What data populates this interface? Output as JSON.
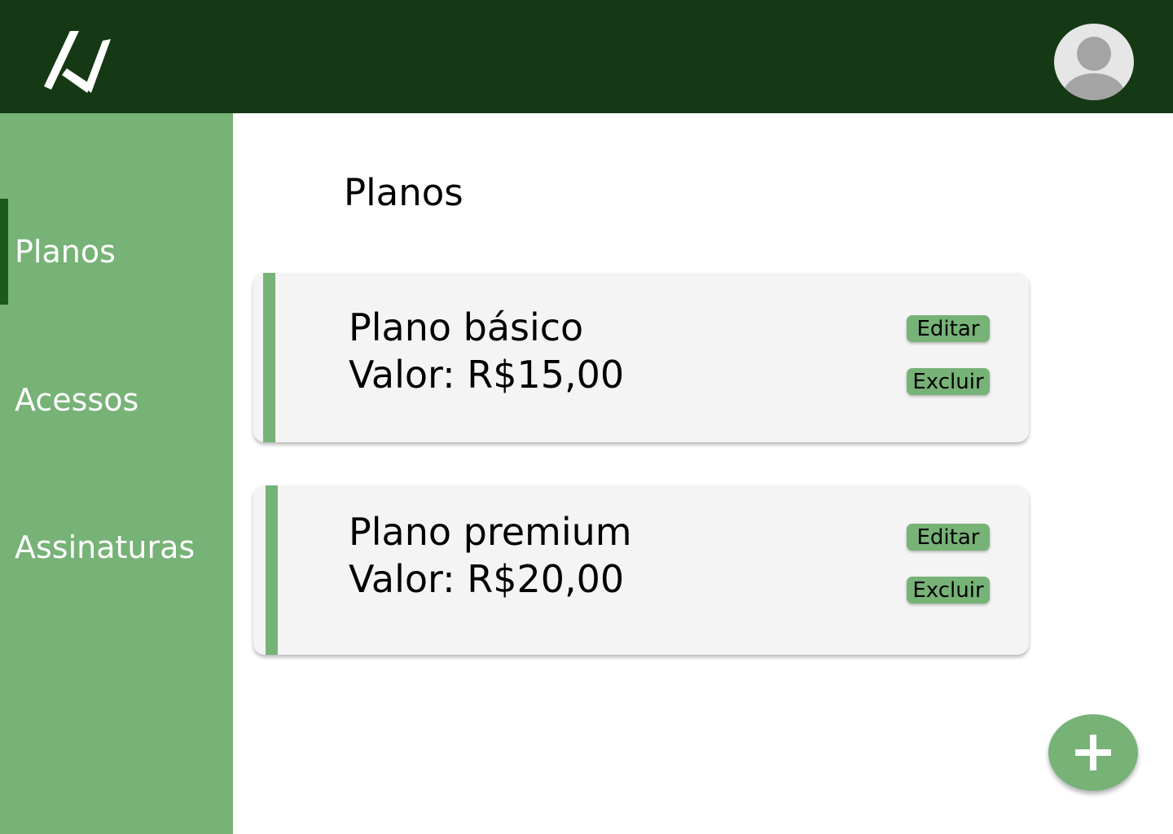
{
  "header": {
    "logo_icon": "arrow-n-logo-icon",
    "avatar_icon": "user-avatar-icon"
  },
  "sidebar": {
    "items": [
      {
        "label": "Planos",
        "active": true
      },
      {
        "label": "Acessos",
        "active": false
      },
      {
        "label": "Assinaturas",
        "active": false
      }
    ]
  },
  "main": {
    "title": "Planos",
    "plans": [
      {
        "name": "Plano básico",
        "value": "Valor: R$15,00",
        "edit_label": "Editar",
        "delete_label": "Excluir"
      },
      {
        "name": "Plano premium",
        "value": "Valor: R$20,00",
        "edit_label": "Editar",
        "delete_label": "Excluir"
      }
    ],
    "add_icon": "plus-icon"
  },
  "colors": {
    "header_bg": "#143914",
    "sidebar_bg": "#77b277",
    "accent": "#77b277",
    "active_indicator": "#1a5a1a",
    "card_bg": "#f4f4f4"
  }
}
